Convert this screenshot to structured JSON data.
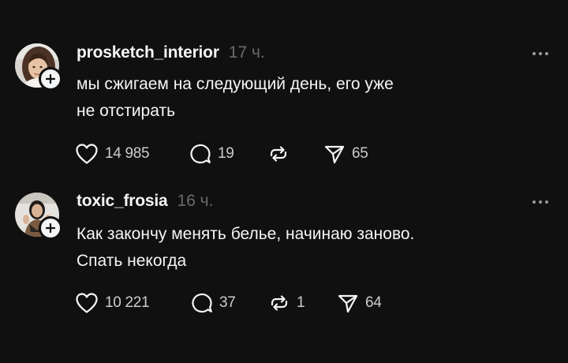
{
  "posts": [
    {
      "username": "prosketch_interior",
      "timestamp": "17 ч.",
      "text_lines": [
        "мы сжигаем на следующий день, его уже",
        "не отстирать"
      ],
      "stats": {
        "likes": "14 985",
        "replies": "19",
        "reposts": "",
        "shares": "65"
      },
      "icons": {
        "like": "heart-icon",
        "reply": "comment-icon",
        "repost": "repost-icon",
        "share": "send-icon",
        "more": "more-icon",
        "follow": "plus-icon"
      }
    },
    {
      "username": "toxic_frosia",
      "timestamp": "16 ч.",
      "text_lines": [
        "Как закончу менять белье, начинаю заново.",
        "Спать некогда"
      ],
      "stats": {
        "likes": "10 221",
        "replies": "37",
        "reposts": "1",
        "shares": "64"
      },
      "icons": {
        "like": "heart-icon",
        "reply": "comment-icon",
        "repost": "repost-icon",
        "share": "send-icon",
        "more": "more-icon",
        "follow": "plus-icon"
      }
    }
  ],
  "colors": {
    "background": "#101010",
    "primary_text": "#f3f5f7",
    "secondary_text": "#6b6b6b",
    "action_text": "#cccccc"
  }
}
